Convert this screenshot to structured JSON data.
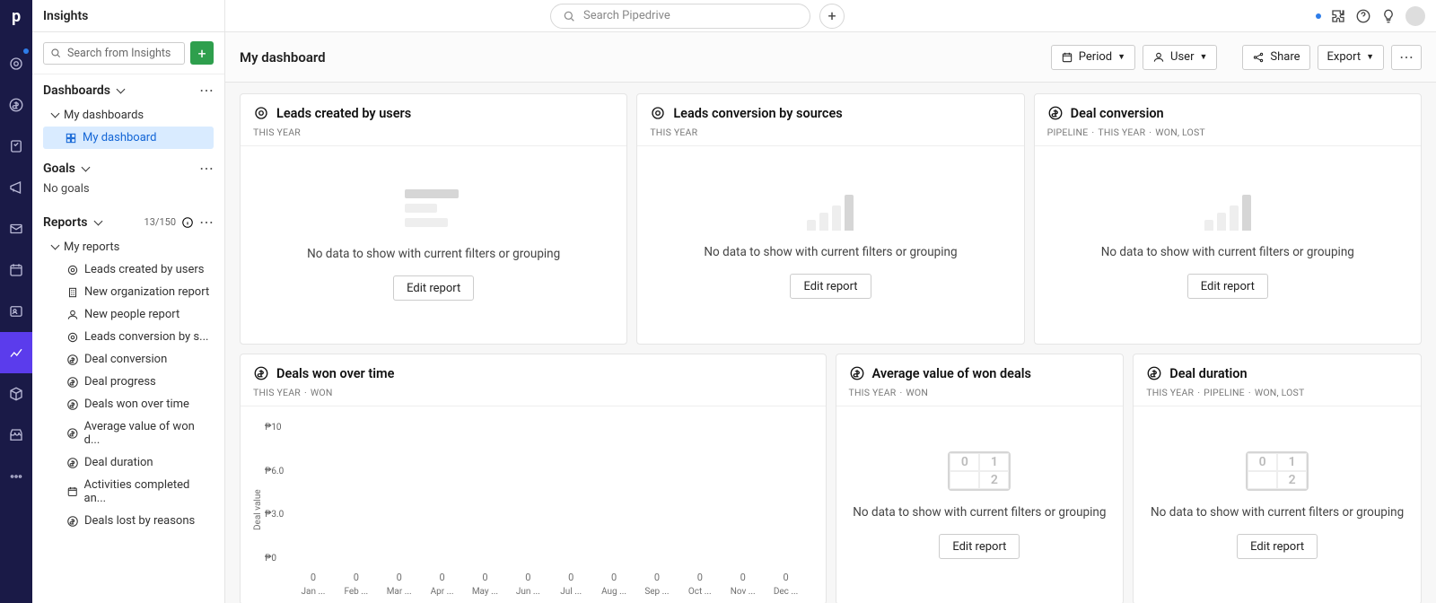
{
  "app_title": "Insights",
  "search": {
    "sidebar_placeholder": "Search from Insights",
    "header_placeholder": "Search Pipedrive"
  },
  "sidebar": {
    "dashboards_label": "Dashboards",
    "my_dashboards_label": "My dashboards",
    "current_dashboard": "My dashboard",
    "goals_label": "Goals",
    "no_goals": "No goals",
    "reports_label": "Reports",
    "reports_count": "13/150",
    "my_reports_label": "My reports",
    "reports": [
      "Leads created by users",
      "New organization report",
      "New people report",
      "Leads conversion by s...",
      "Deal conversion",
      "Deal progress",
      "Deals won over time",
      "Average value of won d...",
      "Deal duration",
      "Activities completed an...",
      "Deals lost by reasons"
    ]
  },
  "toolbar": {
    "page_title": "My dashboard",
    "period": "Period",
    "user": "User",
    "share": "Share",
    "export": "Export"
  },
  "empty_msg": "No data to show with current filters or grouping",
  "edit_label": "Edit report",
  "cards": [
    {
      "title": "Leads created by users",
      "meta": [
        "THIS YEAR"
      ],
      "icon": "target",
      "type": "empty-hbar"
    },
    {
      "title": "Leads conversion by sources",
      "meta": [
        "THIS YEAR"
      ],
      "icon": "target",
      "type": "empty-vbar"
    },
    {
      "title": "Deal conversion",
      "meta": [
        "PIPELINE",
        "THIS YEAR",
        "WON, LOST"
      ],
      "icon": "dollar",
      "type": "empty-vbar"
    },
    {
      "title": "Deals won over time",
      "meta": [
        "THIS YEAR",
        "WON"
      ],
      "icon": "dollar",
      "type": "chart"
    },
    {
      "title": "Average value of won deals",
      "meta": [
        "THIS YEAR",
        "WON"
      ],
      "icon": "dollar",
      "type": "empty-012"
    },
    {
      "title": "Deal duration",
      "meta": [
        "THIS YEAR",
        "PIPELINE",
        "WON, LOST"
      ],
      "icon": "dollar",
      "type": "empty-012"
    }
  ],
  "chart_data": {
    "type": "bar",
    "title": "Deals won over time",
    "ylabel": "Deal value",
    "xlabel": "",
    "yticks": [
      "₱10",
      "₱6.0",
      "₱3.0",
      "₱0"
    ],
    "ylim": [
      0,
      10
    ],
    "categories": [
      "Jan ...",
      "Feb ...",
      "Mar ...",
      "Apr ...",
      "May ...",
      "Jun ...",
      "Jul ...",
      "Aug ...",
      "Sep ...",
      "Oct ...",
      "Nov ...",
      "Dec ..."
    ],
    "values": [
      0,
      0,
      0,
      0,
      0,
      0,
      0,
      0,
      0,
      0,
      0,
      0
    ]
  }
}
